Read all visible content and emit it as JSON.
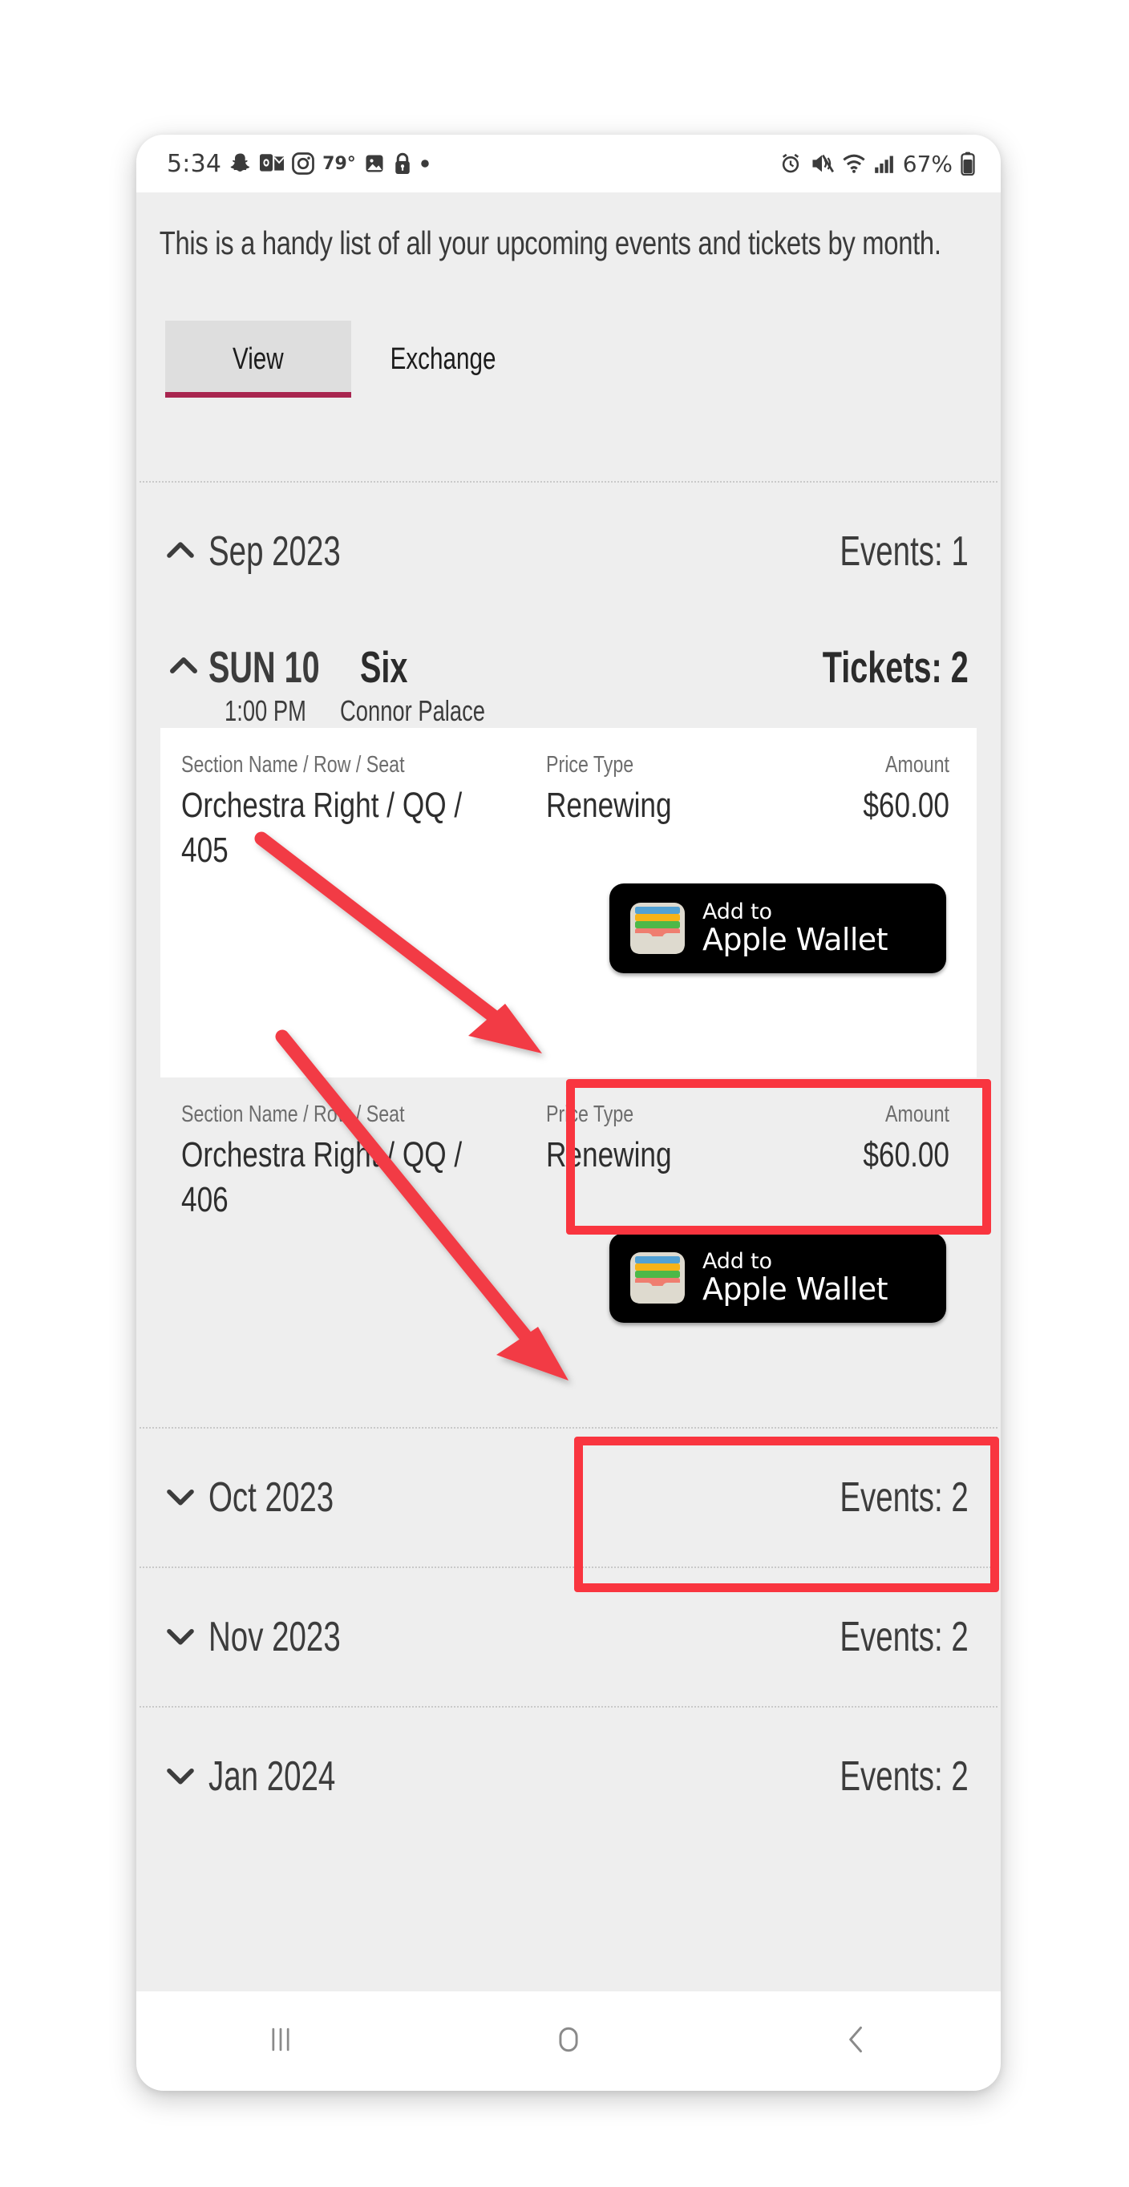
{
  "status_bar": {
    "time": "5:34",
    "temperature": "79°",
    "battery_percent": "67%",
    "left_icons": [
      "snapchat-icon",
      "outlook-icon",
      "instagram-icon",
      "temperature-label",
      "photos-icon",
      "lock-icon",
      "dot-indicator"
    ],
    "right_icons": [
      "alarm-icon",
      "vibrate-mute-icon",
      "wifi-icon",
      "cellular-signal-icon",
      "battery-icon"
    ]
  },
  "intro": {
    "text": "This is a handy list of all your upcoming events and tickets by month."
  },
  "tabs": {
    "items": [
      {
        "label": "View",
        "active": true
      },
      {
        "label": "Exchange",
        "active": false
      }
    ],
    "active_underline_color": "#a8254f"
  },
  "months": [
    {
      "name": "Sep 2023",
      "count_label": "Events: 1",
      "expanded": true,
      "chevron": "chevron-up-icon"
    },
    {
      "name": "Oct 2023",
      "count_label": "Events: 2",
      "expanded": false,
      "chevron": "chevron-down-icon"
    },
    {
      "name": "Nov 2023",
      "count_label": "Events: 2",
      "expanded": false,
      "chevron": "chevron-down-icon"
    },
    {
      "name": "Jan 2024",
      "count_label": "Events: 2",
      "expanded": false,
      "chevron": "chevron-down-icon"
    }
  ],
  "event": {
    "chevron": "chevron-up-icon",
    "date": "SUN 10",
    "title": "Six",
    "tickets_label": "Tickets: 2",
    "time": "1:00 PM",
    "venue": "Connor Palace"
  },
  "ticket_columns": {
    "section": "Section Name / Row / Seat",
    "price_type": "Price Type",
    "amount": "Amount"
  },
  "tickets": [
    {
      "section": "Orchestra Right / QQ / 405",
      "price_type": "Renewing",
      "amount": "$60.00",
      "wallet_button": {
        "line1": "Add to",
        "line2": "Apple Wallet",
        "icon": "apple-wallet-icon"
      }
    },
    {
      "section": "Orchestra Right / QQ / 406",
      "price_type": "Renewing",
      "amount": "$60.00",
      "wallet_button": {
        "line1": "Add to",
        "line2": "Apple Wallet",
        "icon": "apple-wallet-icon"
      }
    }
  ],
  "annotations": {
    "highlight_color": "#f9353f",
    "arrow_color": "#f23b45",
    "boxes": 2,
    "arrows": 2
  },
  "nav_bar": {
    "recents": "recents-icon",
    "home": "home-icon",
    "back": "back-icon"
  }
}
